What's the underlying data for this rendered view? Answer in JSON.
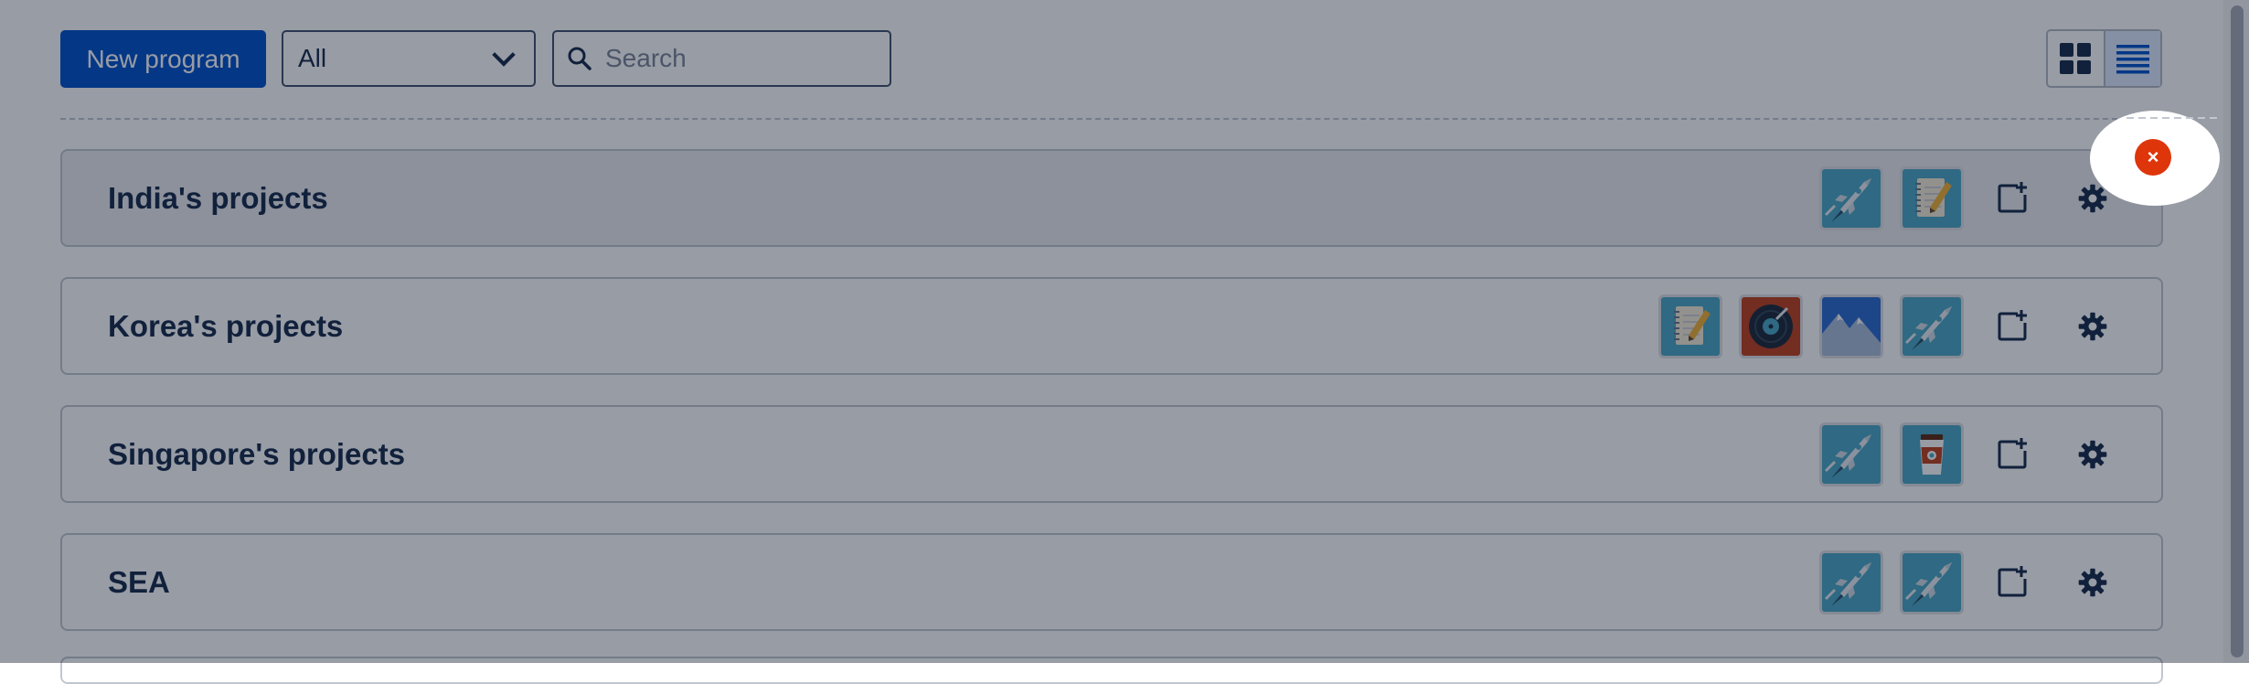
{
  "toolbar": {
    "new_program_label": "New program",
    "filter_selected": "All",
    "search_placeholder": "Search"
  },
  "view_toggle": {
    "grid_icon": "grid-view-icon",
    "list_icon": "list-view-icon",
    "active": "list"
  },
  "programs": [
    {
      "name": "India's projects",
      "apps": [
        "rocket-app-icon",
        "notepad-app-icon"
      ]
    },
    {
      "name": "Korea's projects",
      "apps": [
        "notepad-app-icon",
        "vinyl-record-app-icon",
        "mountain-app-icon",
        "rocket-app-icon"
      ]
    },
    {
      "name": "Singapore's projects",
      "apps": [
        "rocket-app-icon",
        "coffee-cup-app-icon"
      ]
    },
    {
      "name": "SEA",
      "apps": [
        "rocket-app-icon",
        "rocket-app-icon"
      ]
    }
  ],
  "row_actions": {
    "add_icon": "add-project-icon",
    "settings_icon": "gear-icon"
  },
  "spotlight": {
    "close_icon": "close-icon",
    "close_glyph": "×"
  },
  "colors": {
    "primary": "#0052cc",
    "danger": "#de350b",
    "overlay": "#091426"
  }
}
